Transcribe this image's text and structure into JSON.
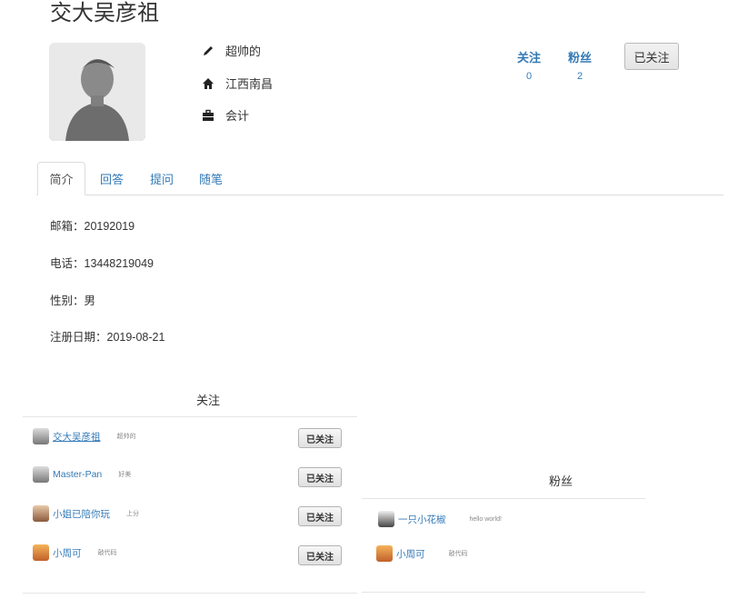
{
  "profile": {
    "name": "交大吴彦祖",
    "signature": "超帅的",
    "location": "江西南昌",
    "job": "会计"
  },
  "stats": {
    "following_label": "关注",
    "following_count": "0",
    "fans_label": "粉丝",
    "fans_count": "2"
  },
  "follow_button": "已关注",
  "tabs": [
    "简介",
    "回答",
    "提问",
    "随笔"
  ],
  "details": {
    "email": "邮箱：20192019",
    "phone": "电话：13448219049",
    "gender": "性别：男",
    "register": "注册日期：2019-08-21"
  },
  "following_section": {
    "title": "关注",
    "items": [
      {
        "name": "交大吴彦祖",
        "sig": "超帅的",
        "button": "已关注"
      },
      {
        "name": "Master-Pan",
        "sig": "好美",
        "button": "已关注"
      },
      {
        "name": "小姐已陪你玩",
        "sig": "上分",
        "button": "已关注"
      },
      {
        "name": "小周可",
        "sig": "敲代码",
        "button": "已关注"
      }
    ]
  },
  "fans_section": {
    "title": "粉丝",
    "items": [
      {
        "name": "一只小花椒",
        "sig": "hello world!"
      },
      {
        "name": "小周可",
        "sig": "敲代码"
      }
    ]
  },
  "colors": {
    "link": "#337ab7",
    "border": "#dddddd"
  }
}
